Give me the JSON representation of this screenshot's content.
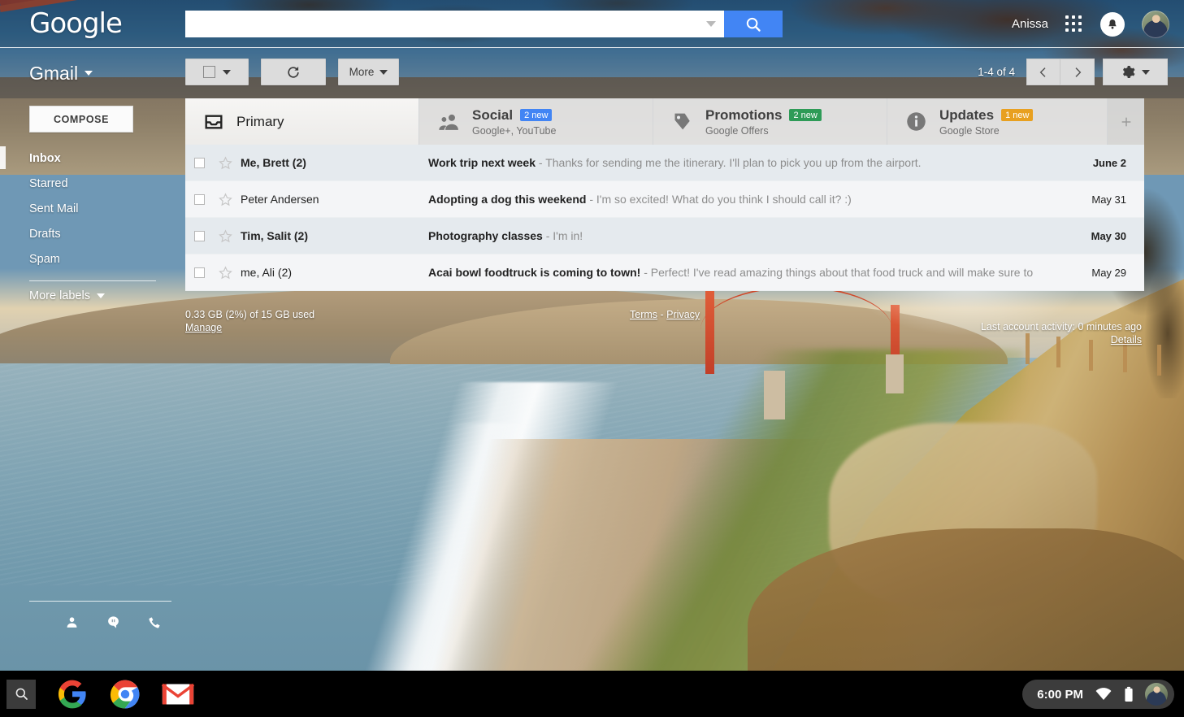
{
  "header": {
    "logo_text": "Google",
    "user_name": "Anissa",
    "apps_icon": "apps-grid-icon",
    "notifications_icon": "bell-icon",
    "avatar_icon": "user-avatar"
  },
  "search": {
    "value": "",
    "placeholder": "",
    "dropdown_icon": "chevron-down-icon",
    "button_icon": "search-icon",
    "button_color": "#4285f4"
  },
  "app": {
    "title": "Gmail",
    "title_caret_icon": "chevron-down-icon"
  },
  "toolbar": {
    "select_all_icon": "checkbox-icon",
    "select_all_caret_icon": "chevron-down-icon",
    "refresh_icon": "refresh-icon",
    "more_label": "More",
    "more_caret_icon": "chevron-down-icon",
    "page_count": "1-4 of 4",
    "prev_icon": "chevron-left-icon",
    "next_icon": "chevron-right-icon",
    "settings_icon": "gear-icon",
    "settings_caret_icon": "chevron-down-icon"
  },
  "sidebar": {
    "compose_label": "COMPOSE",
    "items": [
      {
        "label": "Inbox",
        "active": true
      },
      {
        "label": "Starred",
        "active": false
      },
      {
        "label": "Sent Mail",
        "active": false
      },
      {
        "label": "Drafts",
        "active": false
      },
      {
        "label": "Spam",
        "active": false
      }
    ],
    "more_labels": "More labels",
    "more_labels_caret_icon": "chevron-down-icon",
    "hangouts_icons": [
      "person-icon",
      "chat-bubble-icon",
      "phone-icon"
    ]
  },
  "tabs": [
    {
      "name": "Primary",
      "sub": "",
      "badge": "",
      "badge_color": "",
      "icon": "inbox-tray-icon",
      "active": true
    },
    {
      "name": "Social",
      "sub": "Google+, YouTube",
      "badge": "2 new",
      "badge_color": "#4285f4",
      "icon": "people-icon",
      "active": false
    },
    {
      "name": "Promotions",
      "sub": "Google Offers",
      "badge": "2 new",
      "badge_color": "#2e9b57",
      "icon": "tag-icon",
      "active": false
    },
    {
      "name": "Updates",
      "sub": "Google Store",
      "badge": "1 new",
      "badge_color": "#e8a020",
      "icon": "info-icon",
      "active": false
    }
  ],
  "tab_add_icon": "plus-icon",
  "mail": {
    "rows": [
      {
        "sender": "Me, Brett (2)",
        "subject": "Work trip next week",
        "preview": " - Thanks for sending me the itinerary. I'll plan to pick you up from the airport.",
        "date": "June 2",
        "unread": true
      },
      {
        "sender": "Peter Andersen",
        "subject": "Adopting a dog this weekend",
        "preview": " - I'm so excited! What do you think I should call it? :)",
        "date": "May 31",
        "unread": false
      },
      {
        "sender": "Tim, Salit (2)",
        "subject": "Photography classes",
        "preview": "  - I'm in!",
        "date": "May 30",
        "unread": true
      },
      {
        "sender": "me, Ali (2)",
        "subject": "Acai bowl foodtruck is coming to town!",
        "preview": "  - Perfect! I've read amazing things about that food truck and will make sure to",
        "date": "May 29",
        "unread": false
      }
    ]
  },
  "footer": {
    "storage": "0.33 GB (2%) of 15 GB used",
    "manage": "Manage",
    "terms": "Terms",
    "separator": "-",
    "privacy": "Privacy",
    "activity": "Last account activity: 0 minutes ago",
    "details": "Details"
  },
  "taskbar": {
    "search_icon": "search-icon",
    "apps": [
      {
        "name": "google-search-app",
        "icon": "google-g-icon",
        "active": false
      },
      {
        "name": "chrome-app",
        "icon": "chrome-icon",
        "active": false
      },
      {
        "name": "gmail-app",
        "icon": "gmail-icon",
        "active": true
      }
    ],
    "time": "6:00 PM",
    "wifi_icon": "wifi-icon",
    "battery_icon": "battery-icon",
    "avatar_icon": "user-avatar"
  }
}
